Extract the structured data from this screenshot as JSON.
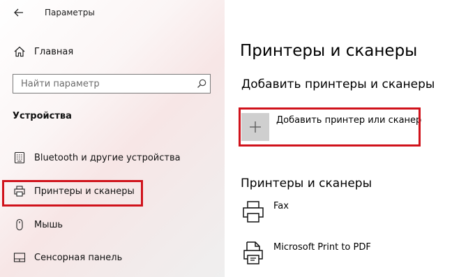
{
  "window": {
    "title": "Параметры"
  },
  "sidebar": {
    "home_label": "Главная",
    "search_placeholder": "Найти параметр",
    "section_title": "Устройства",
    "items": [
      {
        "label": "Bluetooth и другие устройства",
        "icon": "keyboard-icon"
      },
      {
        "label": "Принтеры и сканеры",
        "icon": "printer-icon",
        "selected": true
      },
      {
        "label": "Мышь",
        "icon": "mouse-icon"
      },
      {
        "label": "Сенсорная панель",
        "icon": "touchpad-icon"
      }
    ]
  },
  "main": {
    "title": "Принтеры и сканеры",
    "add_section_title": "Добавить принтеры и сканеры",
    "add_button_label": "Добавить принтер или сканер",
    "printers_section_title": "Принтеры и сканеры",
    "printers": [
      {
        "name": "Fax",
        "icon": "fax-printer-icon"
      },
      {
        "name": "Microsoft Print to PDF",
        "icon": "pdf-printer-icon"
      }
    ]
  },
  "colors": {
    "highlight": "#d0121b",
    "add_button_bg": "#cfcfcf"
  }
}
